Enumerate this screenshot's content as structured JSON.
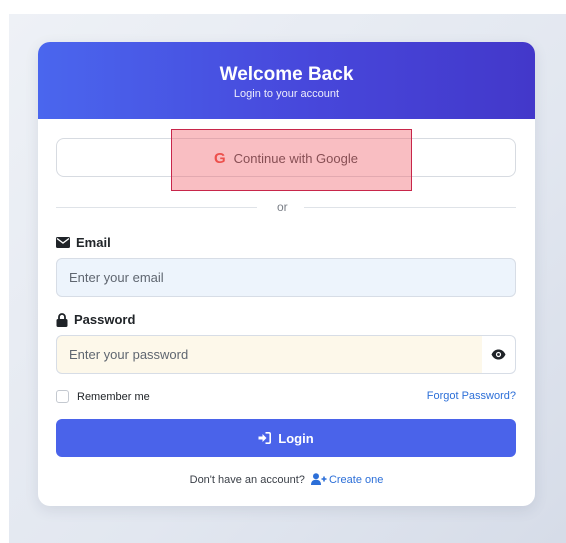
{
  "header": {
    "title": "Welcome Back",
    "subtitle": "Login to your account"
  },
  "google": {
    "icon_letter": "G",
    "label": "Continue with Google"
  },
  "divider_text": "or",
  "email": {
    "label": "Email",
    "icon": "envelope-icon",
    "placeholder": "Enter your email",
    "value": ""
  },
  "password": {
    "label": "Password",
    "icon": "lock-icon",
    "placeholder": "Enter your password",
    "value": "",
    "toggle_icon": "eye-icon"
  },
  "remember_me": {
    "label": "Remember me",
    "checked": false
  },
  "forgot_password": "Forgot Password?",
  "login_button": {
    "label": "Login",
    "icon": "sign-in-icon"
  },
  "signup": {
    "prompt": "Don't have an account?",
    "link": "Create one",
    "icon": "user-plus-icon"
  },
  "colors": {
    "header_gradient_start": "#4a66ee",
    "header_gradient_end": "#4338ca",
    "primary_button": "#4a63ea",
    "link": "#2c6fd8",
    "email_input_bg": "#edf4fc",
    "password_input_bg": "#fdf8ea",
    "highlight_overlay": "#f0646e"
  }
}
